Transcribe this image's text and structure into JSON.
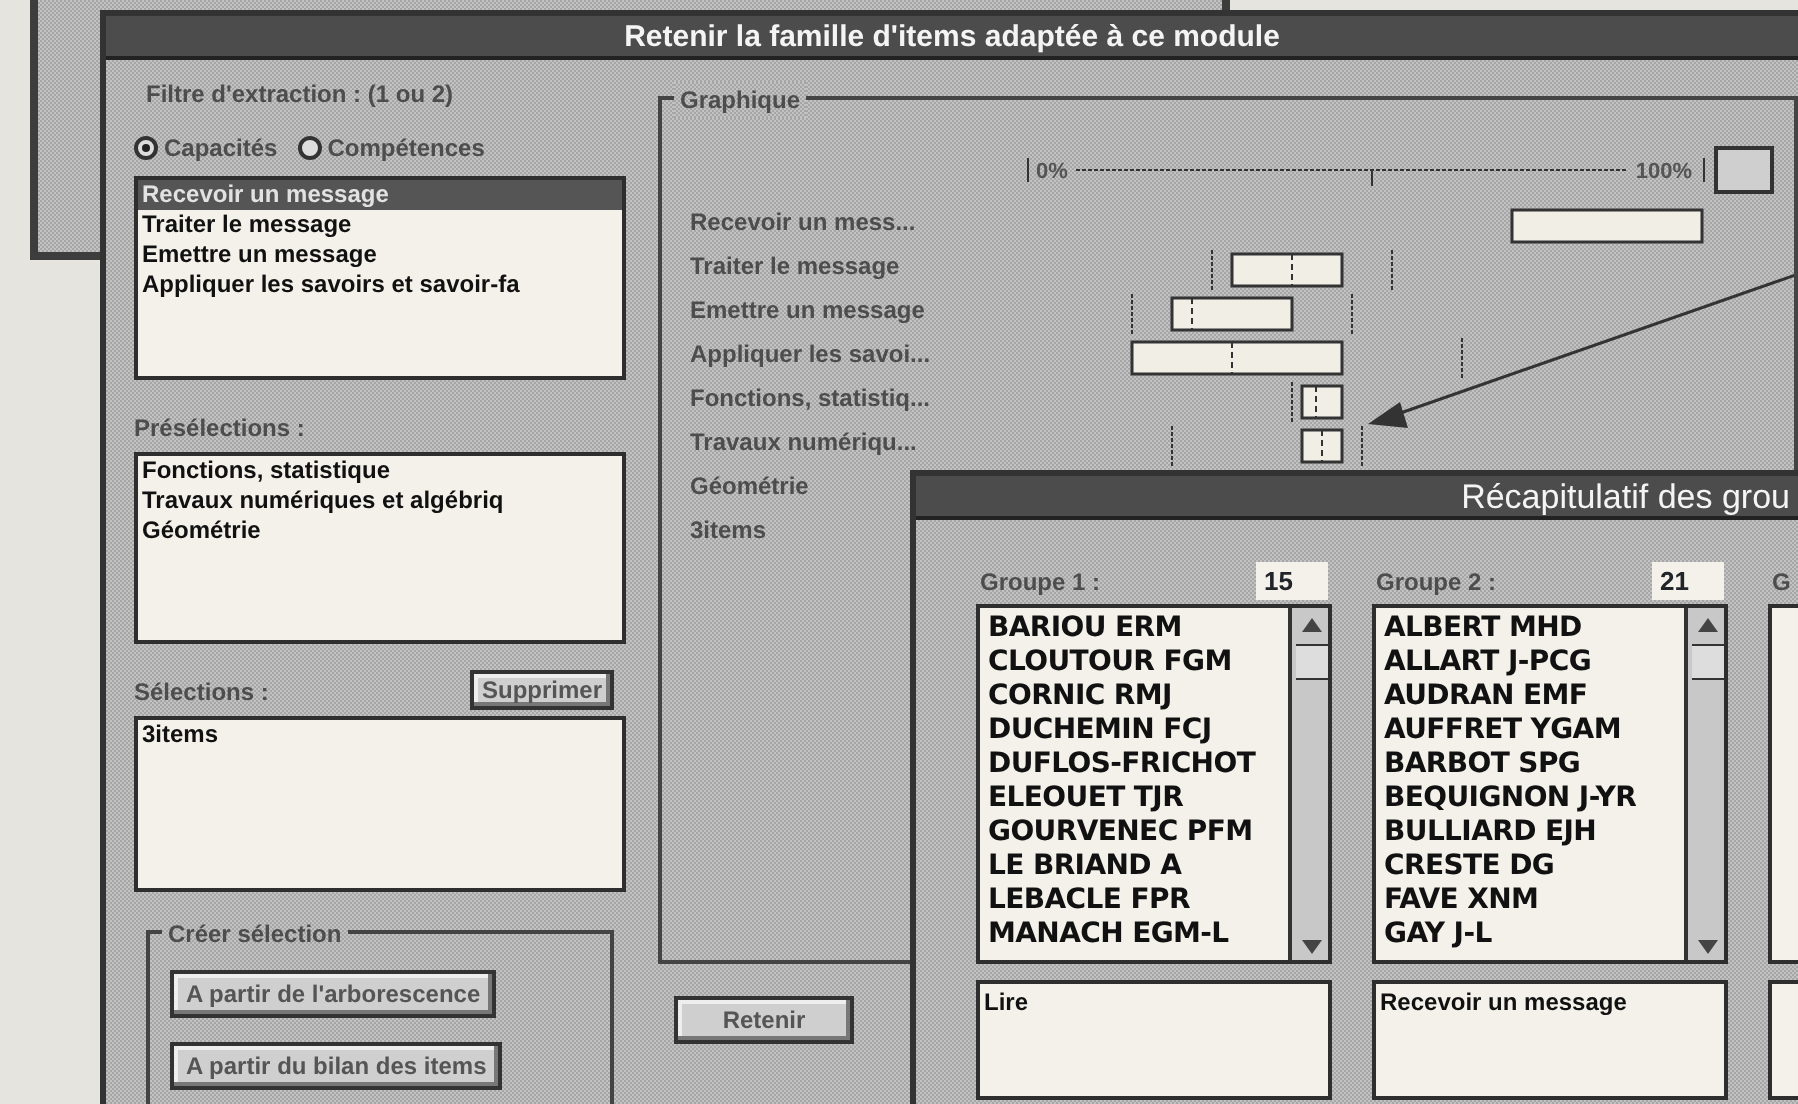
{
  "main_dialog": {
    "title": "Retenir la famille d'items adaptée à ce module",
    "filter_label": "Filtre d'extraction : (1 ou 2)",
    "radios": [
      {
        "label": "Capacités",
        "selected": true
      },
      {
        "label": "Compétences",
        "selected": false
      }
    ],
    "capacities": [
      {
        "label": "Recevoir un message",
        "selected": true
      },
      {
        "label": "Traiter le message",
        "selected": false
      },
      {
        "label": "Emettre un message",
        "selected": false
      },
      {
        "label": "Appliquer les savoirs et savoir-fa",
        "selected": false
      }
    ],
    "preselections_label": "Présélections :",
    "preselections": [
      "Fonctions, statistique",
      "Travaux numériques et algébriq",
      "Géométrie"
    ],
    "selections_label": "Sélections :",
    "delete_button": "Supprimer",
    "selections": [
      "3items"
    ],
    "create_group": {
      "label": "Créer sélection",
      "buttons": [
        "A partir de l'arborescence",
        "A partir du bilan des items"
      ]
    },
    "graph": {
      "label": "Graphique",
      "axis_start": "0%",
      "axis_end": "100%",
      "rows": [
        "Recevoir un mess...",
        "Traiter le message",
        "Emettre un message",
        "Appliquer les savoi...",
        "Fonctions, statistiq...",
        "Travaux numériqu...",
        "Géométrie",
        "3items"
      ]
    },
    "retain_button": "Retenir"
  },
  "summary_dialog": {
    "title": "Récapitulatif des grou",
    "groups": [
      {
        "label": "Groupe 1 :",
        "count": "15",
        "members": [
          "BARIOU ERM",
          "CLOUTOUR FGM",
          "CORNIC RMJ",
          "DUCHEMIN FCJ",
          "DUFLOS-FRICHOT",
          "ELEOUET TJR",
          "GOURVENEC PFM",
          "LE BRIAND A",
          "LEBACLE FPR",
          "MANACH EGM-L"
        ],
        "detail": "Lire"
      },
      {
        "label": "Groupe 2 :",
        "count": "21",
        "members": [
          "ALBERT MHD",
          "ALLART J-PCG",
          "AUDRAN EMF",
          "AUFFRET YGAM",
          "BARBOT SPG",
          "BEQUIGNON J-YR",
          "BULLIARD EJH",
          "CRESTE DG",
          "FAVE XNM",
          "GAY J-L"
        ],
        "detail": "Recevoir un message"
      },
      {
        "label": "G"
      }
    ]
  }
}
